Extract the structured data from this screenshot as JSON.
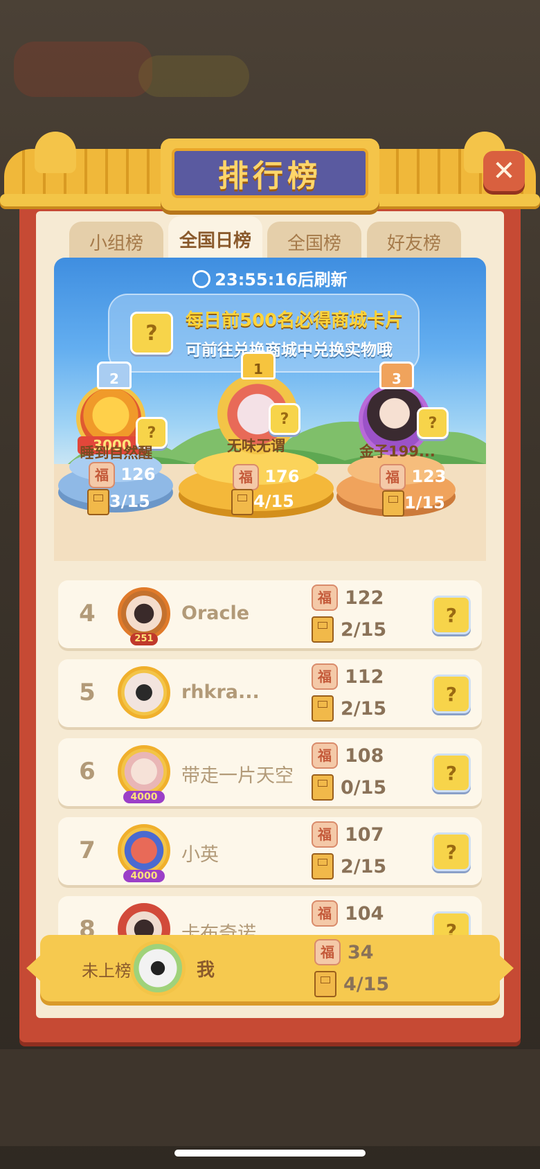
{
  "title": "排行榜",
  "tabs": [
    {
      "label": "小组榜",
      "active": false
    },
    {
      "label": "全国日榜",
      "active": true
    },
    {
      "label": "全国榜",
      "active": false
    },
    {
      "label": "好友榜",
      "active": false
    }
  ],
  "banner": {
    "timer": "23:55:16后刷新",
    "reward_line1": "每日前500名必得商城卡片",
    "reward_line2": "可前往兑换商城中兑换实物哦",
    "puzzle_glyph": "?"
  },
  "podium": [
    {
      "rank": "2",
      "name": "睡到自然醒",
      "badge": "3000",
      "score": "126",
      "progress": "3/15"
    },
    {
      "rank": "1",
      "name": "无味无谓",
      "score": "176",
      "progress": "4/15"
    },
    {
      "rank": "3",
      "name": "金子199...",
      "score": "123",
      "progress": "1/15"
    }
  ],
  "list": [
    {
      "rank": "4",
      "name": "Oracle",
      "score": "122",
      "progress": "2/15",
      "avatar_badge": "251"
    },
    {
      "rank": "5",
      "name": "rhkra...",
      "score": "112",
      "progress": "2/15"
    },
    {
      "rank": "6",
      "name": "带走一片天空",
      "score": "108",
      "progress": "0/15",
      "avatar_badge": "4000"
    },
    {
      "rank": "7",
      "name": "小英",
      "score": "107",
      "progress": "2/15",
      "avatar_badge": "4000"
    },
    {
      "rank": "8",
      "name": "卡布奇诺",
      "score": "104",
      "progress": ""
    }
  ],
  "me": {
    "status": "未上榜",
    "name": "我",
    "score": "34",
    "progress": "4/15"
  },
  "icons": {
    "close": "close-icon",
    "fu": "福",
    "book": "book-icon",
    "clock": "clock-icon"
  },
  "colors": {
    "frame": "#c64a34",
    "plaque": "#5a5aa0",
    "gold": "#f6c94f",
    "text_muted": "#b29a78"
  }
}
